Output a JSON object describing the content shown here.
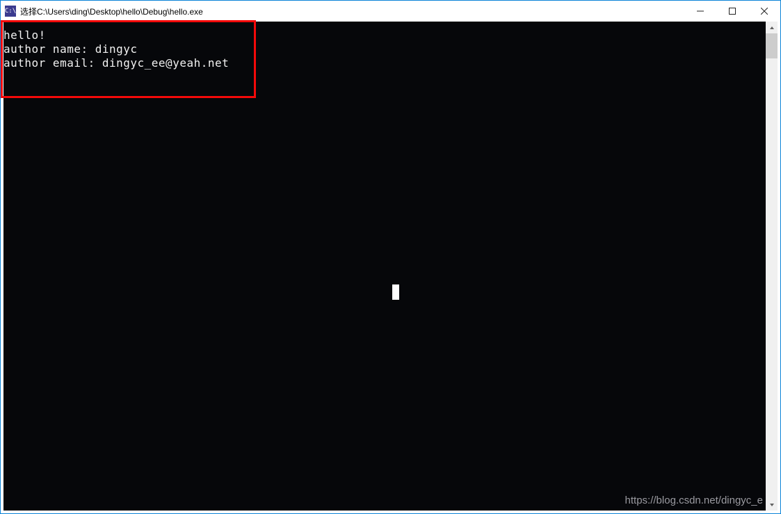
{
  "window": {
    "title": "选择C:\\Users\\ding\\Desktop\\hello\\Debug\\hello.exe",
    "icon_label": "C:\\"
  },
  "console": {
    "lines": [
      "hello!",
      "author name: dingyc",
      "author email: dingyc_ee@yeah.net"
    ]
  },
  "watermark": "https://blog.csdn.net/dingyc_e"
}
